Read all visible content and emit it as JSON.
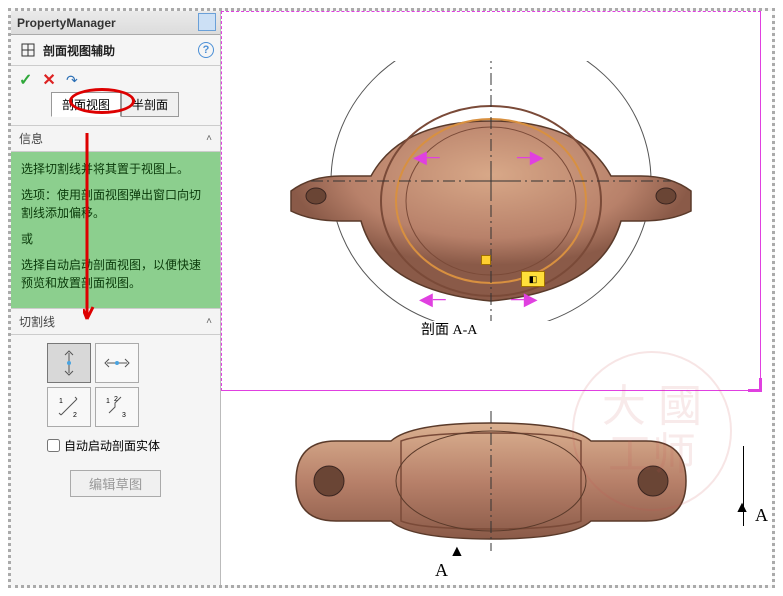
{
  "header": {
    "title": "PropertyManager"
  },
  "assist": {
    "title": "剖面视图辅助",
    "help": "?"
  },
  "actions": {
    "ok": "✓",
    "cancel": "✕",
    "undo": "↶"
  },
  "tabs": {
    "section": "剖面视图",
    "half": "半剖面"
  },
  "info": {
    "header": "信息",
    "line1": "选择切割线并将其置于视图上。",
    "line2": "选项：使用剖面视图弹出窗口向切割线添加偏移。",
    "line3": "或",
    "line4": "选择自动启动剖面视图，以便快速预览和放置剖面视图。"
  },
  "cut": {
    "header": "切割线",
    "auto_label": "自动启动剖面实体",
    "edit_sketch": "编辑草图"
  },
  "drawing": {
    "section_label": "剖面 A-A",
    "marker_a": "A"
  },
  "watermark": "大 國\n工师"
}
